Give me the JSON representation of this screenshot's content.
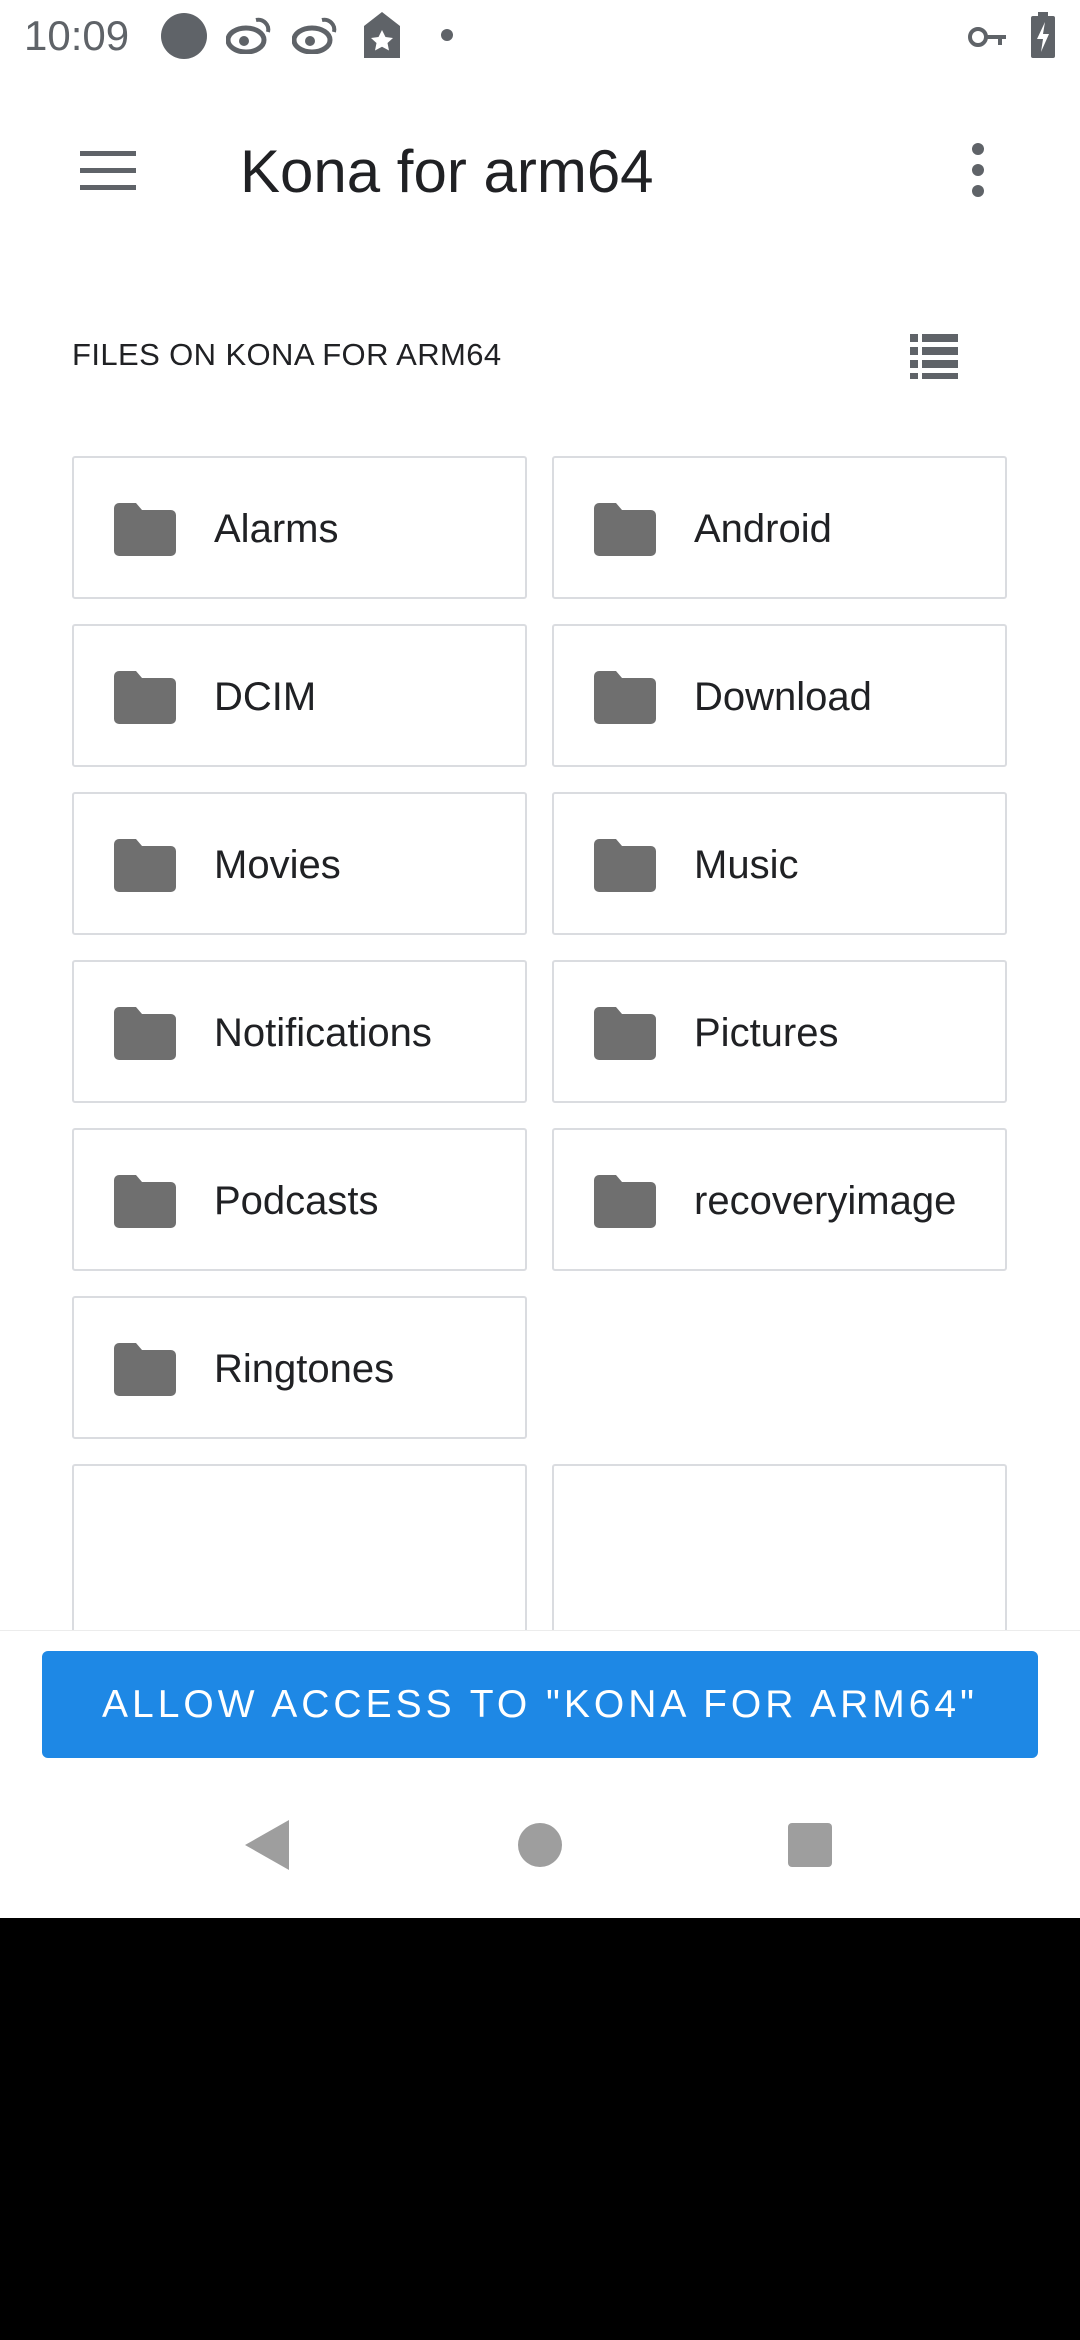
{
  "status_bar": {
    "time": "10:09",
    "icons": [
      "circle-icon",
      "weibo-icon",
      "weibo-icon",
      "star-tag-icon",
      "dot-icon",
      "key-icon",
      "battery-charging-icon"
    ]
  },
  "app_bar": {
    "title": "Kona for arm64",
    "menu_icon": "hamburger-menu-icon",
    "overflow_icon": "more-vert-icon"
  },
  "section": {
    "title": "FILES ON KONA FOR ARM64",
    "view_toggle_icon": "list-view-icon"
  },
  "folders": [
    {
      "label": "Alarms"
    },
    {
      "label": "Android"
    },
    {
      "label": "DCIM"
    },
    {
      "label": "Download"
    },
    {
      "label": "Movies"
    },
    {
      "label": "Music"
    },
    {
      "label": "Notifications"
    },
    {
      "label": "Pictures"
    },
    {
      "label": "Podcasts"
    },
    {
      "label": "recoveryimage"
    },
    {
      "label": "Ringtones"
    }
  ],
  "action": {
    "allow_label": "ALLOW ACCESS TO \"KONA FOR ARM64\""
  },
  "nav_bar": {
    "back_icon": "back-triangle-icon",
    "home_icon": "home-circle-icon",
    "recents_icon": "recents-square-icon"
  },
  "colors": {
    "accent": "#1e88e5",
    "folder_icon": "#6f6f6f",
    "tile_border": "#dadce0"
  }
}
